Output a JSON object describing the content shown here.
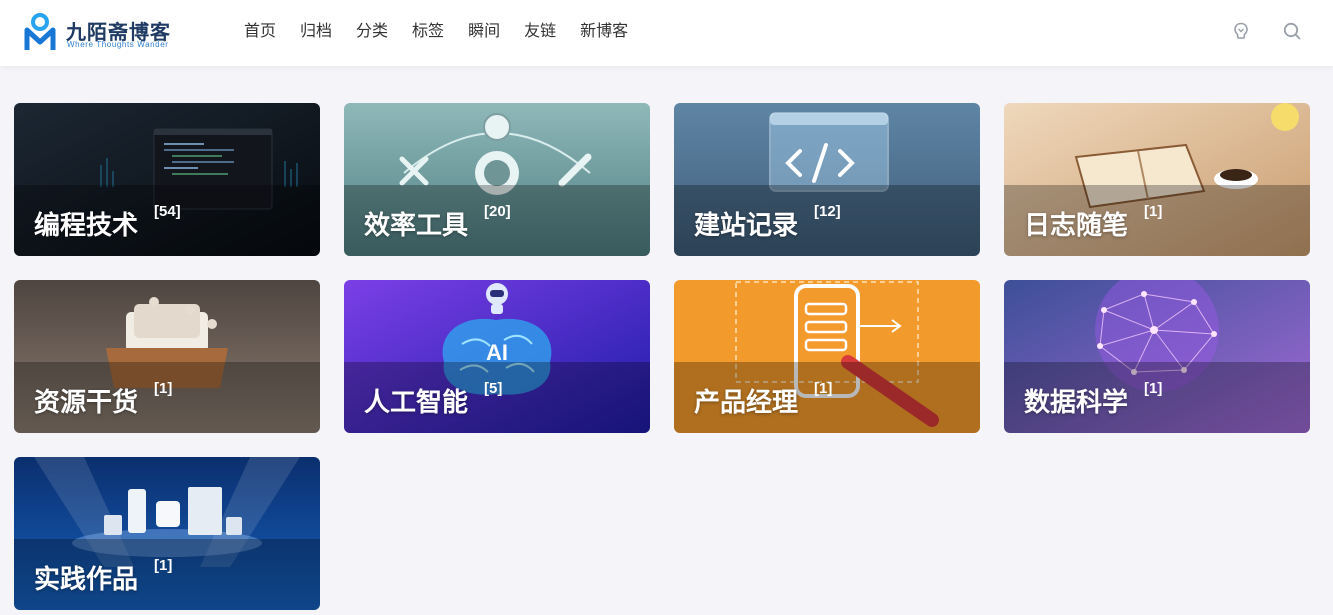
{
  "site": {
    "title": "九陌斋博客",
    "subtitle": "Where Thoughts Wander",
    "brand_color": "#1f3a63",
    "accent_color": "#2f7fd3"
  },
  "nav": {
    "items": [
      "首页",
      "归档",
      "分类",
      "标签",
      "瞬间",
      "友链",
      "新博客"
    ]
  },
  "header_icons": [
    "theme-toggle-icon",
    "search-icon"
  ],
  "categories": [
    {
      "name": "编程技术",
      "count": "[54]",
      "bg": "#0f1720"
    },
    {
      "name": "效率工具",
      "count": "[20]",
      "bg": "#5f8d8f"
    },
    {
      "name": "建站记录",
      "count": "[12]",
      "bg": "#4d6f8c"
    },
    {
      "name": "日志随笔",
      "count": "[1]",
      "bg": "#d9b892"
    },
    {
      "name": "资源干货",
      "count": "[1]",
      "bg": "#6e5e52"
    },
    {
      "name": "人工智能",
      "count": "[5]",
      "bg": "#4b2fc9"
    },
    {
      "name": "产品经理",
      "count": "[1]",
      "bg": "#f39a2c"
    },
    {
      "name": "数据科学",
      "count": "[1]",
      "bg": "#6f58b8"
    },
    {
      "name": "实践作品",
      "count": "[1]",
      "bg": "#0d3e86"
    }
  ]
}
